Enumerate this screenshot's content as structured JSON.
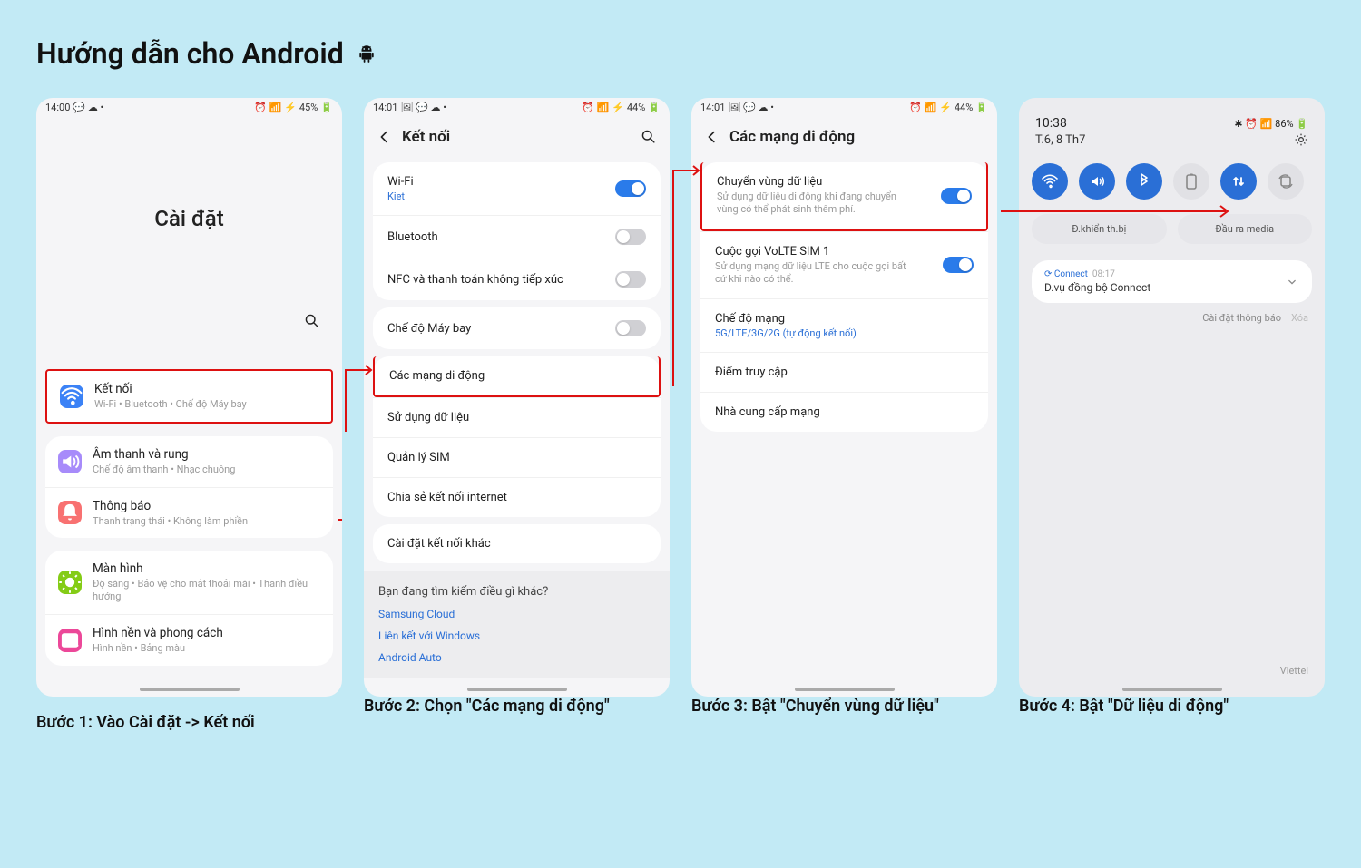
{
  "page_title": "Hướng dẫn cho Android",
  "steps": [
    {
      "caption": "Bước 1: Vào Cài đặt -> Kết nối",
      "status": {
        "time": "14:00",
        "battery_text": "45%"
      },
      "big_header": "Cài đặt",
      "groups": [
        {
          "items": [
            {
              "icon_color": "#3b82f6",
              "icon": "wifi",
              "title": "Kết nối",
              "sub": "Wi-Fi • Bluetooth • Chế độ Máy bay",
              "highlight": true
            }
          ]
        },
        {
          "items": [
            {
              "icon_color": "#a78bfa",
              "icon": "sound",
              "title": "Âm thanh và rung",
              "sub": "Chế độ âm thanh • Nhạc chuông"
            },
            {
              "icon_color": "#f87171",
              "icon": "bell",
              "title": "Thông báo",
              "sub": "Thanh trạng thái • Không làm phiền"
            }
          ]
        },
        {
          "items": [
            {
              "icon_color": "#84cc16",
              "icon": "sun",
              "title": "Màn hình",
              "sub": "Độ sáng • Bảo vệ cho mắt thoải mái • Thanh điều hướng"
            },
            {
              "icon_color": "#ec4899",
              "icon": "image",
              "title": "Hình nền và phong cách",
              "sub": "Hình nền • Bảng màu"
            }
          ]
        }
      ]
    },
    {
      "caption": "Bước 2: Chọn \"Các mạng di động\"",
      "status": {
        "time": "14:01",
        "battery_text": "44%"
      },
      "header": "Kết nối",
      "cards": [
        {
          "rows": [
            {
              "title": "Wi-Fi",
              "sub_link": "Kiet",
              "toggle": "on"
            },
            {
              "title": "Bluetooth",
              "toggle": "off"
            },
            {
              "title": "NFC và thanh toán không tiếp xúc",
              "toggle": "off"
            }
          ]
        },
        {
          "rows": [
            {
              "title": "Chế độ Máy bay",
              "toggle": "off"
            }
          ]
        },
        {
          "rows": [
            {
              "title": "Các mạng di động",
              "highlight": true
            },
            {
              "title": "Sử dụng dữ liệu"
            },
            {
              "title": "Quản lý SIM"
            },
            {
              "title": "Chia sẻ kết nối internet"
            }
          ]
        },
        {
          "rows": [
            {
              "title": "Cài đặt kết nối khác"
            }
          ]
        }
      ],
      "suggest": {
        "prompt": "Bạn đang tìm kiếm điều gì khác?",
        "links": [
          "Samsung Cloud",
          "Liên kết với Windows",
          "Android Auto"
        ]
      }
    },
    {
      "caption": "Bước 3: Bật \"Chuyển vùng dữ liệu\"",
      "status": {
        "time": "14:01",
        "battery_text": "44%"
      },
      "header": "Các mạng di động",
      "cards": [
        {
          "rows": [
            {
              "title": "Chuyển vùng dữ liệu",
              "sub": "Sử dụng dữ liệu di động khi đang chuyển vùng có thể phát sinh thêm phí.",
              "toggle": "on",
              "highlight": true
            },
            {
              "title": "Cuộc gọi VoLTE SIM 1",
              "sub": "Sử dụng mạng dữ liệu LTE cho cuộc gọi bất cứ khi nào có thể.",
              "toggle": "on"
            },
            {
              "title": "Chế độ mạng",
              "sub_link": "5G/LTE/3G/2G (tự động kết nối)"
            },
            {
              "title": "Điểm truy cập"
            },
            {
              "title": "Nhà cung cấp mạng"
            }
          ]
        }
      ]
    },
    {
      "caption": "Bước 4: Bật \"Dữ liệu di động\"",
      "status": {
        "time": "10:38",
        "battery_text": "86%"
      },
      "date_line": "T.6, 8 Th7",
      "qp_icons": [
        {
          "name": "wifi-icon",
          "on": true
        },
        {
          "name": "sound-icon",
          "on": true
        },
        {
          "name": "bluetooth-icon",
          "on": true
        },
        {
          "name": "battery-saver-icon",
          "on": false
        },
        {
          "name": "mobile-data-icon",
          "on": true
        },
        {
          "name": "rotation-icon",
          "on": false
        }
      ],
      "qp_wide": {
        "left": "Đ.khiển th.bị",
        "right": "Đầu ra media"
      },
      "notif": {
        "app": "Connect",
        "time": "08:17",
        "title": "D.vụ đồng bộ Connect"
      },
      "footer_settings": "Cài đặt thông báo",
      "footer_clear": "Xóa",
      "carrier": "Viettel"
    }
  ]
}
